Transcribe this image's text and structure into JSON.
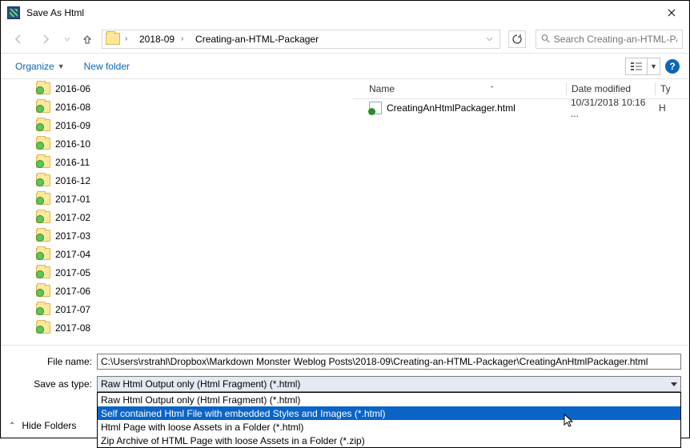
{
  "title": "Save As Html",
  "breadcrumb": {
    "a": "2018-09",
    "b": "Creating-an-HTML-Packager"
  },
  "search_placeholder": "Search Creating-an-HTML-Pa...",
  "toolbar": {
    "organize": "Organize",
    "newfolder": "New folder"
  },
  "help": "?",
  "tree": [
    "2016-06",
    "2016-08",
    "2016-09",
    "2016-10",
    "2016-11",
    "2016-12",
    "2017-01",
    "2017-02",
    "2017-03",
    "2017-04",
    "2017-05",
    "2017-06",
    "2017-07",
    "2017-08"
  ],
  "headers": {
    "name": "Name",
    "date": "Date modified",
    "type": "Ty"
  },
  "files": [
    {
      "name": "CreatingAnHtmlPackager.html",
      "date": "10/31/2018 10:16 ...",
      "type": "H"
    }
  ],
  "filename_label": "File name:",
  "filetype_label": "Save as type:",
  "filename_value": "C:\\Users\\rstrahl\\Dropbox\\Markdown Monster Weblog Posts\\2018-09\\Creating-an-HTML-Packager\\CreatingAnHtmlPackager.html",
  "filetype_value": "Raw Html Output only (Html Fragment) (*.html)",
  "filetype_options": [
    "Raw Html Output only (Html Fragment) (*.html)",
    "Self contained Html File with embedded Styles and Images (*.html)",
    "Html Page with loose Assets in a Folder (*.html)",
    "Zip Archive of HTML Page  with loose Assets in a Folder (*.zip)"
  ],
  "filetype_selected_index": 1,
  "hide_folders": "Hide Folders"
}
